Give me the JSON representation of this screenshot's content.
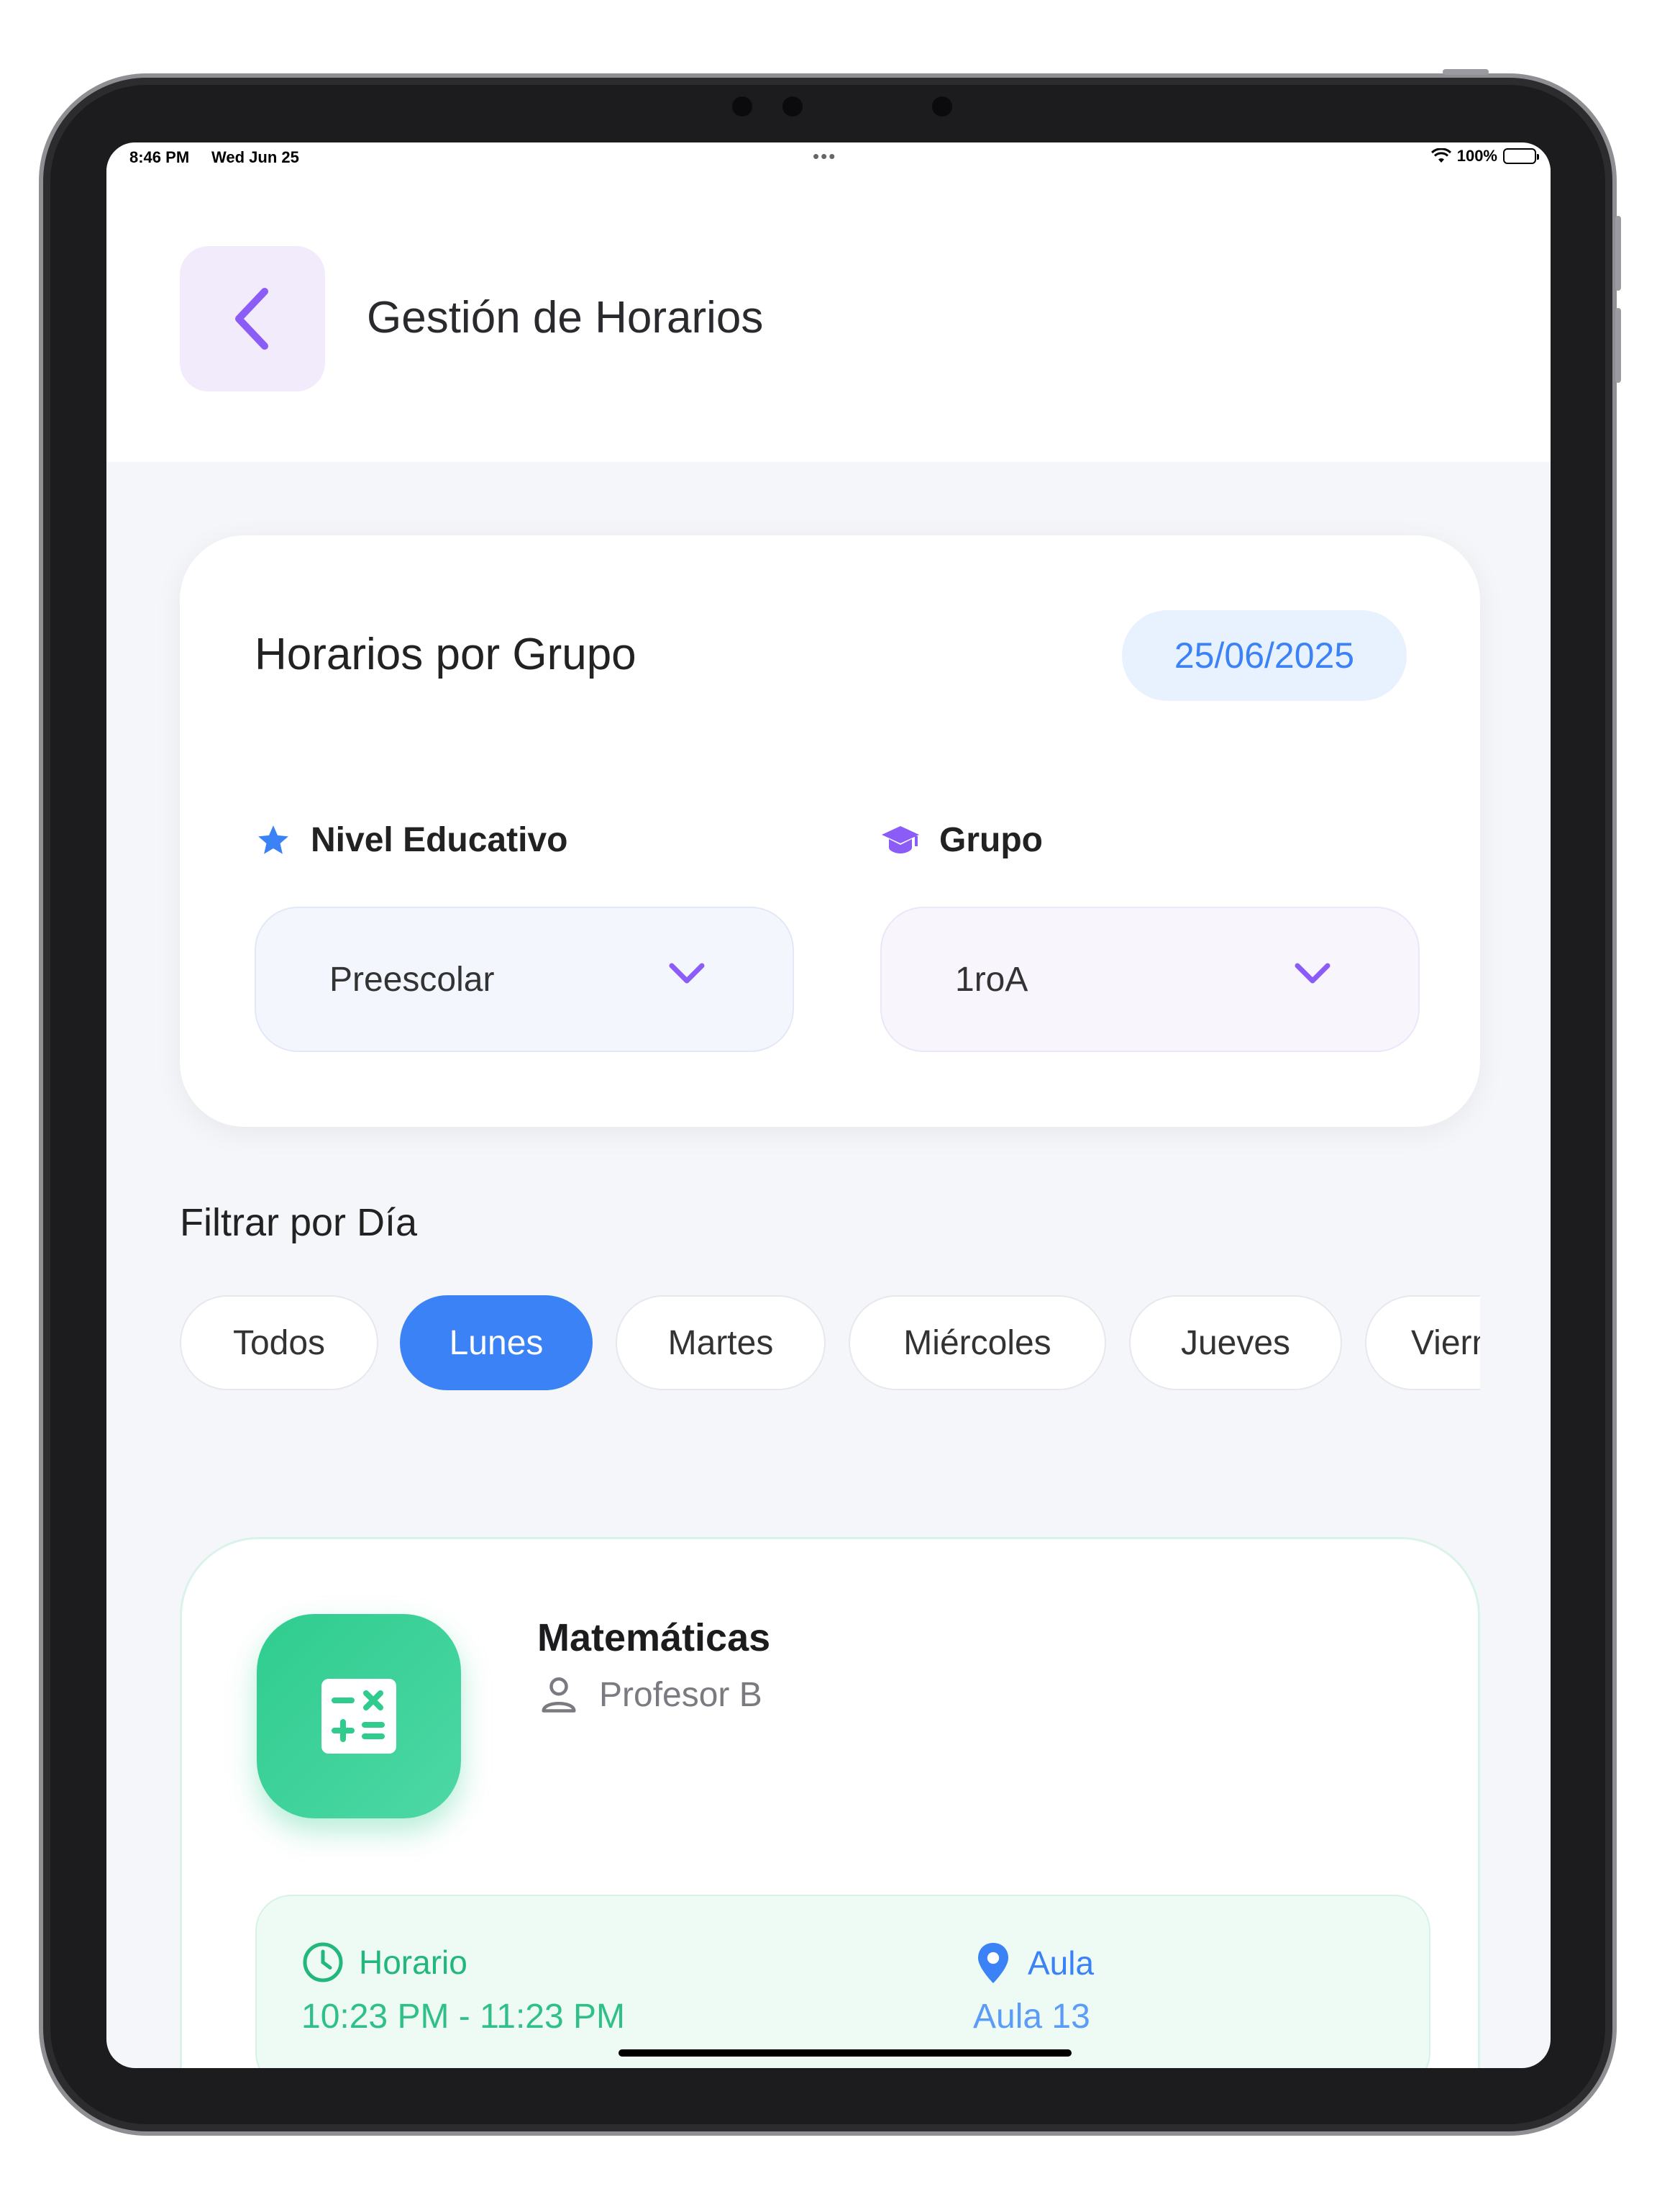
{
  "status_bar": {
    "time": "8:46 PM",
    "date": "Wed Jun 25",
    "battery": "100%"
  },
  "header": {
    "title": "Gestión de Horarios",
    "back_icon": "chevron-left-icon"
  },
  "group_card": {
    "title": "Horarios por Grupo",
    "date": "25/06/2025",
    "level": {
      "label": "Nivel Educativo",
      "icon": "star-icon",
      "value": "Preescolar"
    },
    "group": {
      "label": "Grupo",
      "icon": "graduation-cap-icon",
      "value": "1roA"
    }
  },
  "filter": {
    "title": "Filtrar por Día",
    "days": [
      "Todos",
      "Lunes",
      "Martes",
      "Miércoles",
      "Jueves",
      "Viern"
    ],
    "selected": "Lunes"
  },
  "subject": {
    "name": "Matemáticas",
    "teacher": "Profesor B",
    "icon": "calculator-icon",
    "schedule_label": "Horario",
    "schedule_value": "10:23 PM - 11:23 PM",
    "room_label": "Aula",
    "room_value": "Aula 13"
  },
  "colors": {
    "accent_purple": "#8b5cf6",
    "accent_blue": "#3b82f6",
    "accent_green": "#2fcc8e"
  }
}
